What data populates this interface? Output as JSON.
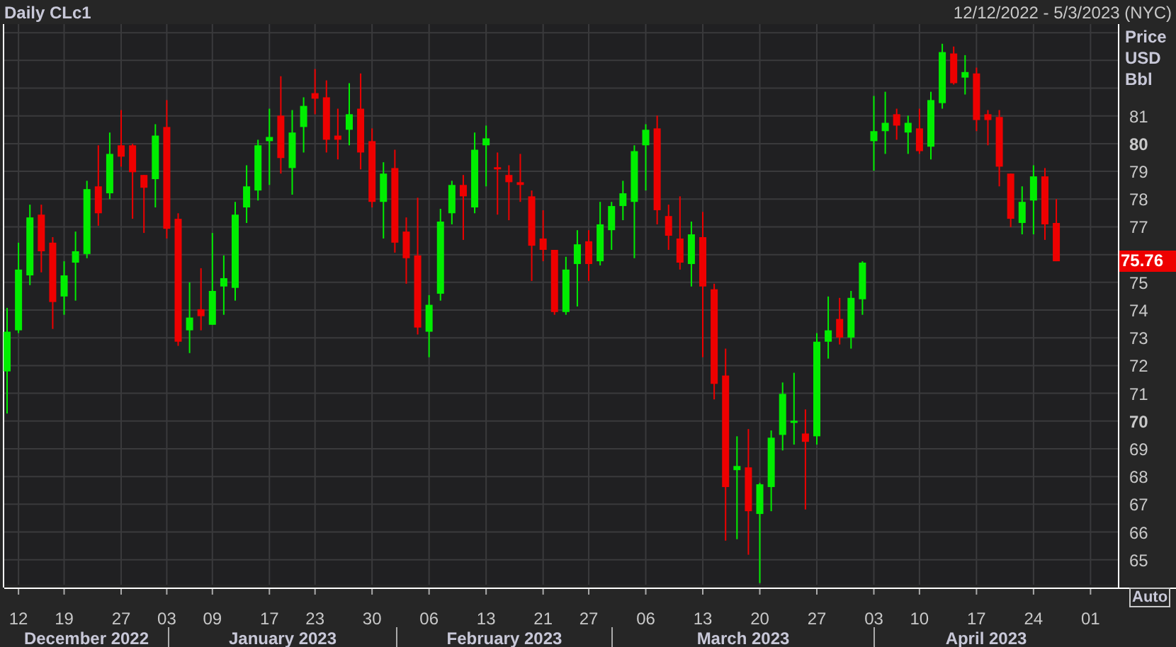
{
  "header": {
    "title": "Daily CLc1",
    "date_range": "12/12/2022 - 5/3/2023 (NYC)"
  },
  "chart_panel": {
    "axis_unit": [
      "Price",
      "USD",
      "Bbl"
    ],
    "month_labels": [
      "December 2022",
      "January 2023",
      "February 2023",
      "March 2023",
      "April 2023"
    ],
    "auto_button": "Auto",
    "chart_data": {
      "type": "candlestick",
      "grid": true,
      "categories": [
        null,
        "12",
        null,
        null,
        null,
        "19",
        null,
        null,
        null,
        null,
        "27",
        null,
        null,
        null,
        "03",
        null,
        null,
        null,
        "09",
        null,
        null,
        null,
        null,
        "17",
        null,
        null,
        null,
        "23",
        null,
        null,
        null,
        null,
        "30",
        null,
        null,
        null,
        null,
        "06",
        null,
        null,
        null,
        null,
        "13",
        null,
        null,
        null,
        null,
        "21",
        null,
        null,
        null,
        "27",
        null,
        null,
        null,
        null,
        "06",
        null,
        null,
        null,
        null,
        "13",
        null,
        null,
        null,
        null,
        "20",
        null,
        null,
        null,
        null,
        "27",
        null,
        null,
        null,
        null,
        "03",
        null,
        null,
        null,
        "10",
        null,
        null,
        null,
        null,
        "17",
        null,
        null,
        null,
        null,
        "24",
        null,
        null,
        null,
        null,
        "01",
        null,
        null
      ],
      "ohlc": [
        [
          71.79,
          74.08,
          70.27,
          73.22
        ],
        [
          73.27,
          76.43,
          73.17,
          75.46
        ],
        [
          75.25,
          77.8,
          74.9,
          77.34
        ],
        [
          77.44,
          77.8,
          75.36,
          76.12
        ],
        [
          76.43,
          76.63,
          73.32,
          74.29
        ],
        [
          74.49,
          75.76,
          73.83,
          75.25
        ],
        [
          75.71,
          76.83,
          74.34,
          76.12
        ],
        [
          76.02,
          78.66,
          75.87,
          78.36
        ],
        [
          78.46,
          79.94,
          77.04,
          77.49
        ],
        [
          78.21,
          80.4,
          78.0,
          79.63
        ],
        [
          79.94,
          81.21,
          79.17,
          79.53
        ],
        [
          79.94,
          79.99,
          77.29,
          78.97
        ],
        [
          78.87,
          78.87,
          76.78,
          78.41
        ],
        [
          78.72,
          80.7,
          77.7,
          80.29
        ],
        [
          80.6,
          81.57,
          76.58,
          76.93
        ],
        [
          77.29,
          77.49,
          72.71,
          72.86
        ],
        [
          73.27,
          75.0,
          72.45,
          73.73
        ],
        [
          74.03,
          75.51,
          73.27,
          73.78
        ],
        [
          73.47,
          76.78,
          73.47,
          74.69
        ],
        [
          74.85,
          75.97,
          73.83,
          75.15
        ],
        [
          74.8,
          77.9,
          74.34,
          77.44
        ],
        [
          77.7,
          79.22,
          77.14,
          78.46
        ],
        [
          78.31,
          80.14,
          77.95,
          79.94
        ],
        [
          80.09,
          81.26,
          78.51,
          80.24
        ],
        [
          81.01,
          82.43,
          78.92,
          79.48
        ],
        [
          79.12,
          81.21,
          78.16,
          80.4
        ],
        [
          80.6,
          81.67,
          79.68,
          81.36
        ],
        [
          81.82,
          82.69,
          81.06,
          81.62
        ],
        [
          81.67,
          82.28,
          79.68,
          80.14
        ],
        [
          80.29,
          81.26,
          79.43,
          80.14
        ],
        [
          80.5,
          82.18,
          79.94,
          81.06
        ],
        [
          81.26,
          82.53,
          79.07,
          79.68
        ],
        [
          80.09,
          80.55,
          77.7,
          77.9
        ],
        [
          77.9,
          79.33,
          76.58,
          78.92
        ],
        [
          79.12,
          79.78,
          76.07,
          76.43
        ],
        [
          76.83,
          77.34,
          74.95,
          75.87
        ],
        [
          75.97,
          78.05,
          73.12,
          73.37
        ],
        [
          73.22,
          74.54,
          72.3,
          74.19
        ],
        [
          74.59,
          77.65,
          74.34,
          77.19
        ],
        [
          77.49,
          78.66,
          77.09,
          78.51
        ],
        [
          78.51,
          78.87,
          76.53,
          78.1
        ],
        [
          77.7,
          80.4,
          77.49,
          79.78
        ],
        [
          79.94,
          80.65,
          78.46,
          80.19
        ],
        [
          79.15,
          79.68,
          77.44,
          79.1
        ],
        [
          78.87,
          79.22,
          77.24,
          78.61
        ],
        [
          78.61,
          79.63,
          77.9,
          78.51
        ],
        [
          78.1,
          78.31,
          75.05,
          76.32
        ],
        [
          76.58,
          77.6,
          75.76,
          76.17
        ],
        [
          76.17,
          76.17,
          73.83,
          73.93
        ],
        [
          73.93,
          75.92,
          73.83,
          75.46
        ],
        [
          75.66,
          76.88,
          74.13,
          76.37
        ],
        [
          76.48,
          76.88,
          75.05,
          75.66
        ],
        [
          75.76,
          77.9,
          75.61,
          77.09
        ],
        [
          76.88,
          77.9,
          76.17,
          77.75
        ],
        [
          77.75,
          78.66,
          77.24,
          78.21
        ],
        [
          77.9,
          79.94,
          75.87,
          79.73
        ],
        [
          79.94,
          80.7,
          78.31,
          80.5
        ],
        [
          80.55,
          81.01,
          77.09,
          77.6
        ],
        [
          77.39,
          77.8,
          76.17,
          76.68
        ],
        [
          76.58,
          78.1,
          75.46,
          75.71
        ],
        [
          75.66,
          77.19,
          74.85,
          76.73
        ],
        [
          76.63,
          77.54,
          72.3,
          74.85
        ],
        [
          74.75,
          74.95,
          70.78,
          71.34
        ],
        [
          71.64,
          72.61,
          65.69,
          67.62
        ],
        [
          68.23,
          69.45,
          65.74,
          68.38
        ],
        [
          68.33,
          69.71,
          65.18,
          66.75
        ],
        [
          66.65,
          67.77,
          64.16,
          67.72
        ],
        [
          67.62,
          69.66,
          66.75,
          69.4
        ],
        [
          69.5,
          71.39,
          68.94,
          70.98
        ],
        [
          69.98,
          71.74,
          69.15,
          70.01
        ],
        [
          69.55,
          70.42,
          66.81,
          69.25
        ],
        [
          69.45,
          73.17,
          69.15,
          72.86
        ],
        [
          72.86,
          74.49,
          72.25,
          73.27
        ],
        [
          73.68,
          74.44,
          72.76,
          73.01
        ],
        [
          73.01,
          74.69,
          72.61,
          74.44
        ],
        [
          74.39,
          75.76,
          73.83,
          75.71
        ],
        [
          80.09,
          81.72,
          79.02,
          80.45
        ],
        [
          80.45,
          81.87,
          79.63,
          80.75
        ],
        [
          81.06,
          81.26,
          80.14,
          80.65
        ],
        [
          80.4,
          81.01,
          79.63,
          80.75
        ],
        [
          80.55,
          81.26,
          79.63,
          79.73
        ],
        [
          79.89,
          81.87,
          79.43,
          81.57
        ],
        [
          81.46,
          83.6,
          81.26,
          83.3
        ],
        [
          83.25,
          83.5,
          82.13,
          82.18
        ],
        [
          82.38,
          83.19,
          81.77,
          82.58
        ],
        [
          82.53,
          82.74,
          80.45,
          80.85
        ],
        [
          81.06,
          81.21,
          79.94,
          80.85
        ],
        [
          80.96,
          81.21,
          78.46,
          79.17
        ],
        [
          78.92,
          78.92,
          76.99,
          77.29
        ],
        [
          77.14,
          78.46,
          76.73,
          77.9
        ],
        [
          77.95,
          79.22,
          76.73,
          78.82
        ],
        [
          78.82,
          79.12,
          76.53,
          77.09
        ],
        [
          77.14,
          78.0,
          75.76,
          75.76
        ],
        null,
        null,
        null,
        null,
        null
      ],
      "ylim": [
        64.1,
        84.31
      ],
      "yticks": [
        65,
        66,
        67,
        68,
        69,
        70,
        71,
        72,
        73,
        74,
        75,
        77,
        78,
        79,
        80,
        81
      ],
      "annotations": [
        "75.76"
      ]
    }
  }
}
